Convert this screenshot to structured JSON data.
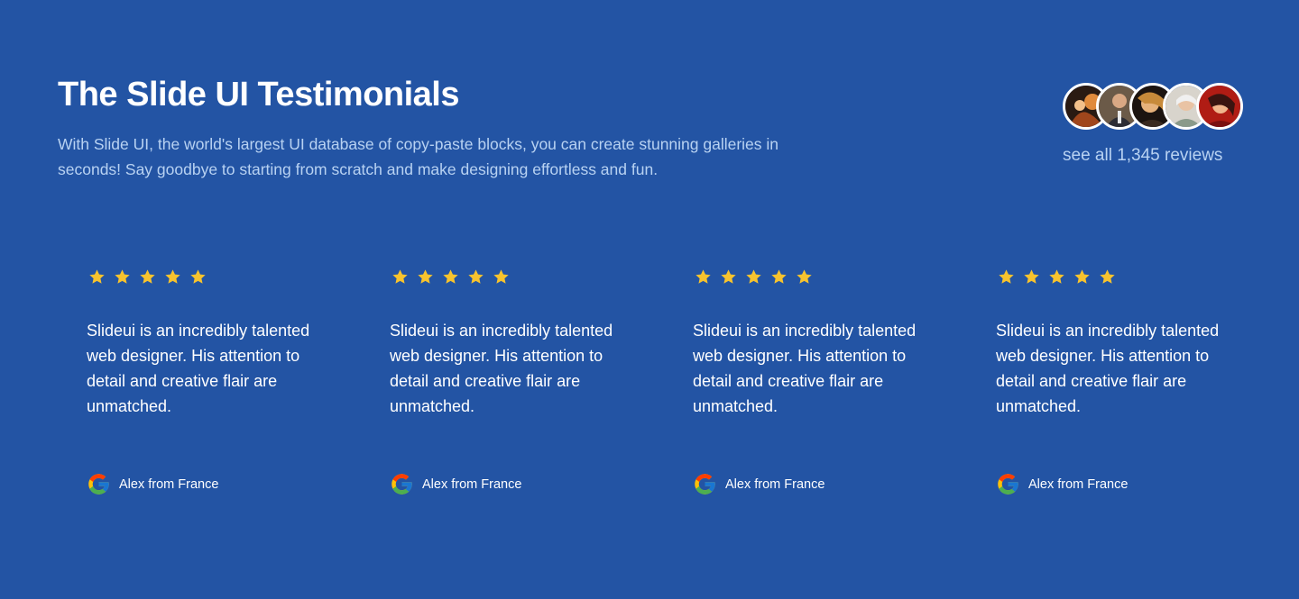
{
  "header": {
    "title": "The Slide UI Testimonials",
    "description": "With Slide UI, the world's largest UI database of copy-paste blocks, you can create stunning galleries in seconds! Say goodbye to starting from scratch and make designing effortless and fun."
  },
  "reviews_summary": {
    "link_text": "see all 1,345 reviews",
    "avatar_count": 5
  },
  "testimonials": [
    {
      "rating": 5,
      "quote": "Slideui is an incredibly talented web designer. His attention to detail and creative flair are unmatched.",
      "author": "Alex from France",
      "source_icon": "google-icon"
    },
    {
      "rating": 5,
      "quote": "Slideui is an incredibly talented web designer. His attention to detail and creative flair are unmatched.",
      "author": "Alex from France",
      "source_icon": "google-icon"
    },
    {
      "rating": 5,
      "quote": "Slideui is an incredibly talented web designer. His attention to detail and creative flair are unmatched.",
      "author": "Alex from France",
      "source_icon": "google-icon"
    },
    {
      "rating": 5,
      "quote": "Slideui is an incredibly talented web designer. His attention to detail and creative flair are unmatched.",
      "author": "Alex from France",
      "source_icon": "google-icon"
    }
  ],
  "colors": {
    "background": "#2354a4",
    "star": "#f7c32e",
    "description_text": "#b8d2f2"
  }
}
